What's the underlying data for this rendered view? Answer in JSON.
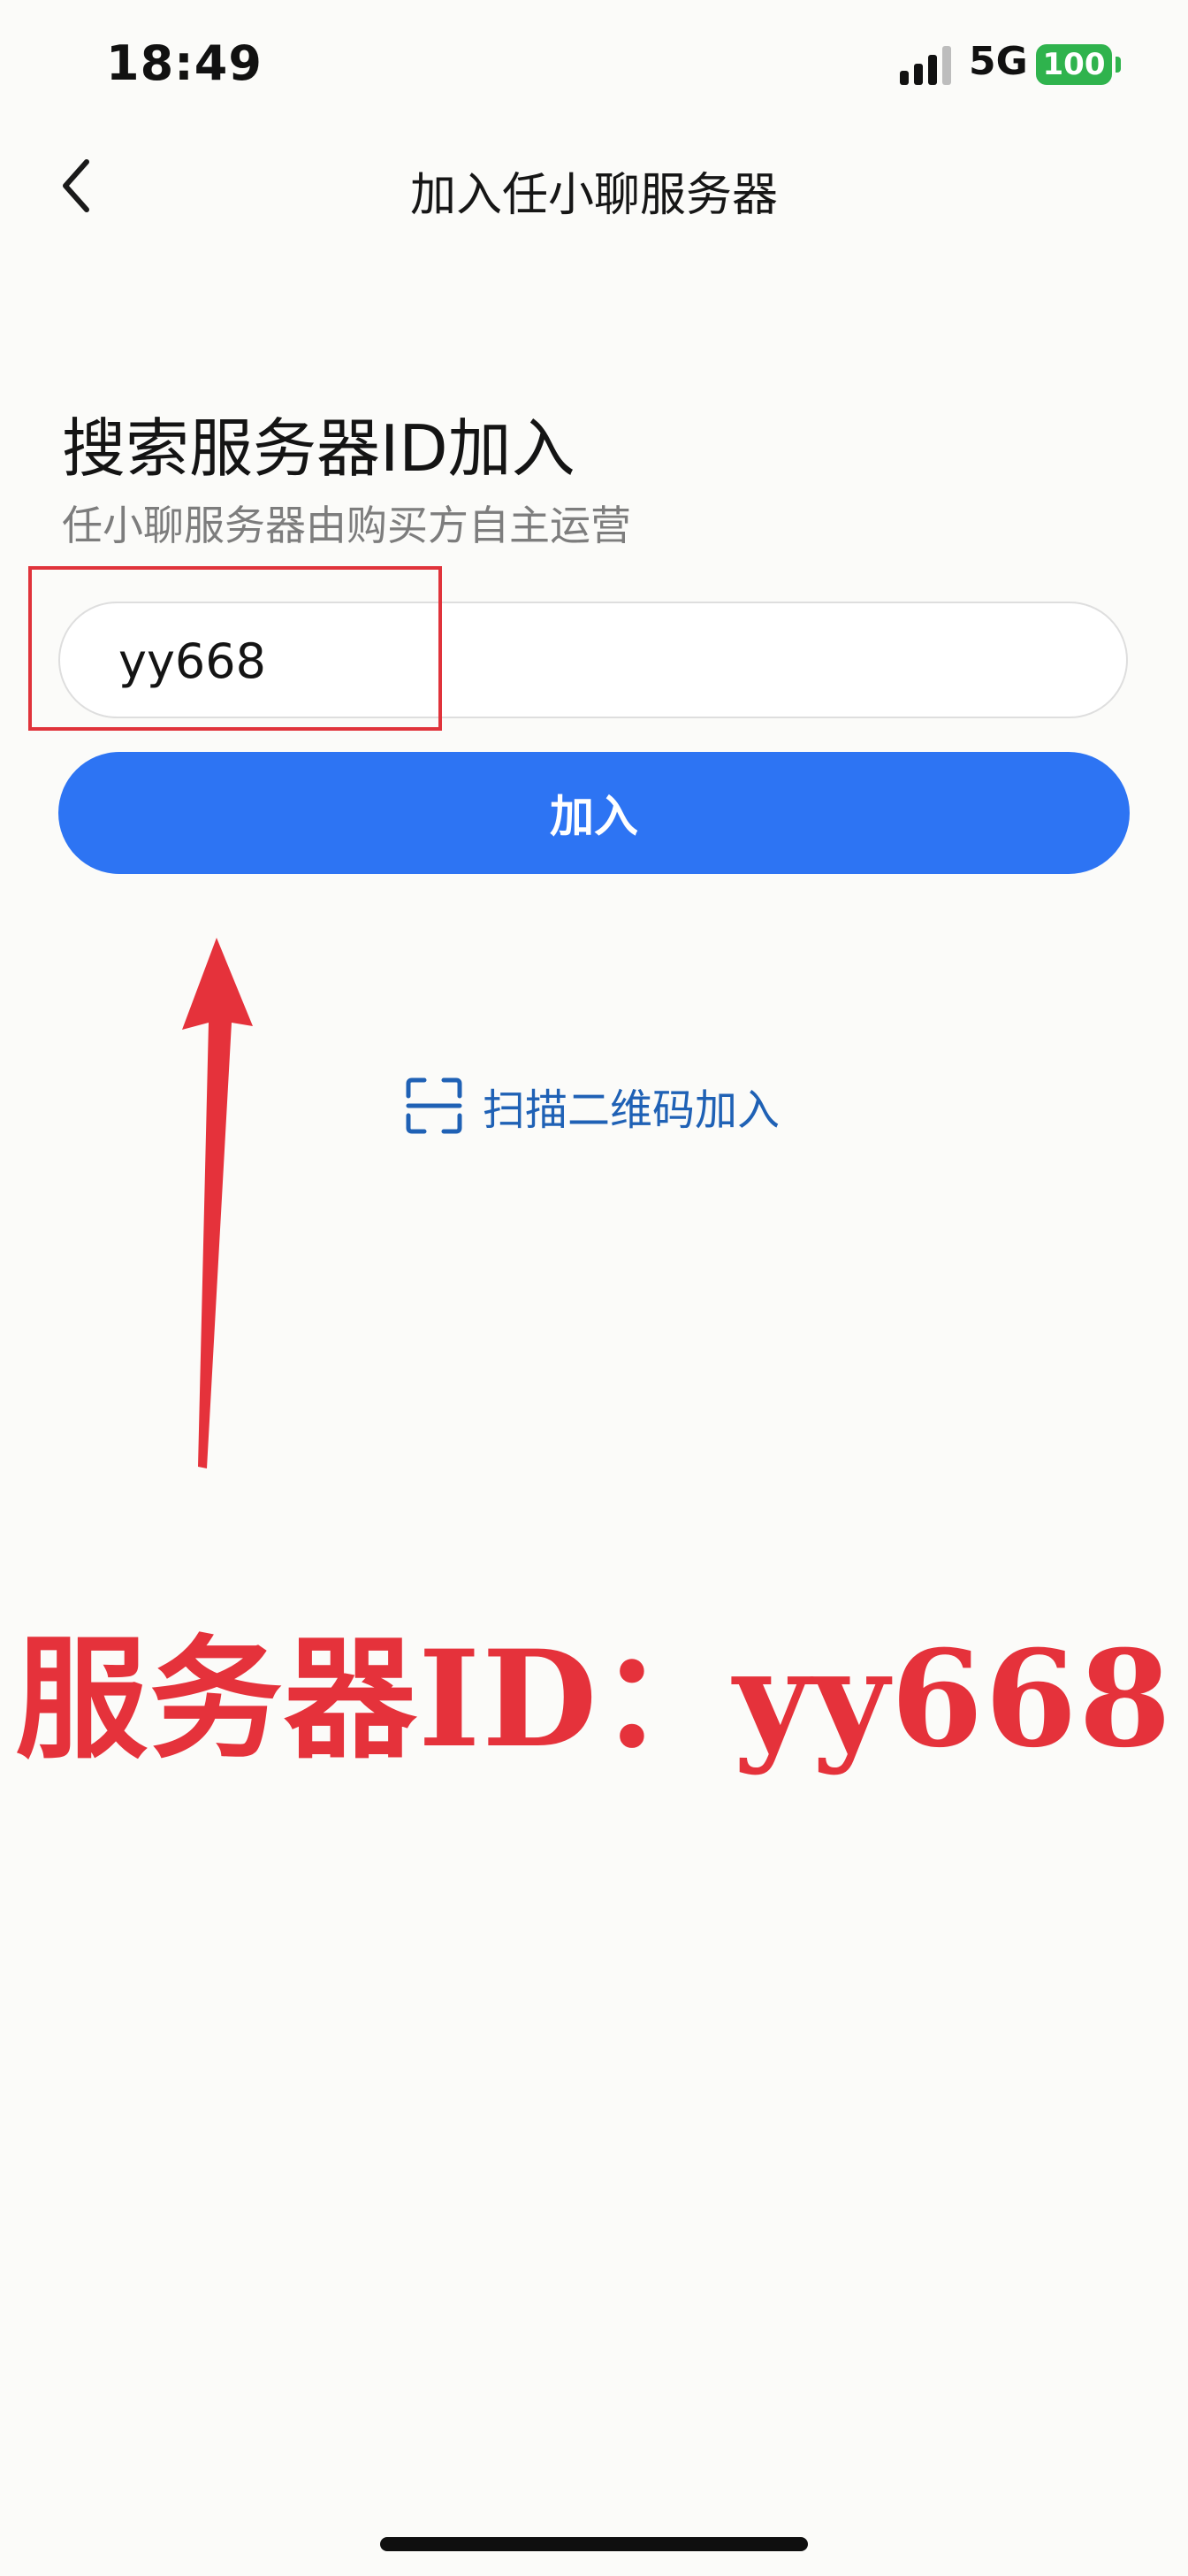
{
  "status_bar": {
    "time": "18:49",
    "network": "5G",
    "battery": "100"
  },
  "header": {
    "title": "加入任小聊服务器",
    "back_icon": "chevron-left-icon"
  },
  "main": {
    "heading": "搜索服务器ID加入",
    "subheading": "任小聊服务器由购买方自主运营",
    "server_id_input": {
      "value": "yy668",
      "placeholder": ""
    },
    "join_button_label": "加入",
    "scan_link": {
      "icon": "qr-scan-icon",
      "label": "扫描二维码加入"
    }
  },
  "annotation": {
    "caption": "服务器ID：yy668",
    "highlight_color": "#e0333b",
    "arrow_color": "#e5323b"
  },
  "colors": {
    "accent": "#2d74f3",
    "link": "#1f61b5",
    "battery": "#2fb34d"
  }
}
